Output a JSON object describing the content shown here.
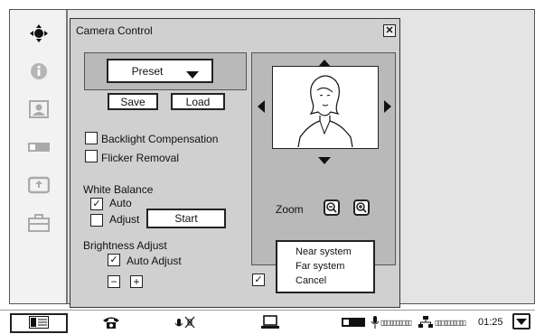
{
  "dialog": {
    "title": "Camera Control",
    "close_symbol": "✕"
  },
  "preset": {
    "selected": "Preset",
    "save_label": "Save",
    "load_label": "Load"
  },
  "options": {
    "backlight_label": "Backlight Compensation",
    "backlight_checked": false,
    "flicker_label": "Flicker Removal",
    "flicker_checked": false
  },
  "white_balance": {
    "heading": "White Balance",
    "auto_label": "Auto",
    "auto_checked": true,
    "adjust_label": "Adjust",
    "adjust_checked": false,
    "start_label": "Start"
  },
  "brightness": {
    "heading": "Brightness Adjust",
    "auto_adjust_label": "Auto Adjust",
    "auto_adjust_checked": true,
    "minus": "−",
    "plus": "+"
  },
  "camera": {
    "zoom_label": "Zoom"
  },
  "bottom_checkbox_checked": true,
  "popup": {
    "items": [
      "Near system",
      "Far system",
      "Cancel"
    ]
  },
  "sidebar": {
    "icons": [
      "camera-move-icon",
      "info-icon",
      "contact-icon",
      "device-icon",
      "share-icon",
      "toolbox-icon"
    ]
  },
  "taskbar": {
    "time": "01:25",
    "status_text_1": "▯▯▯▯▯▯▯▯▯▯",
    "status_text_2": "▯▯▯▯▯▯▯▯▯▯"
  }
}
